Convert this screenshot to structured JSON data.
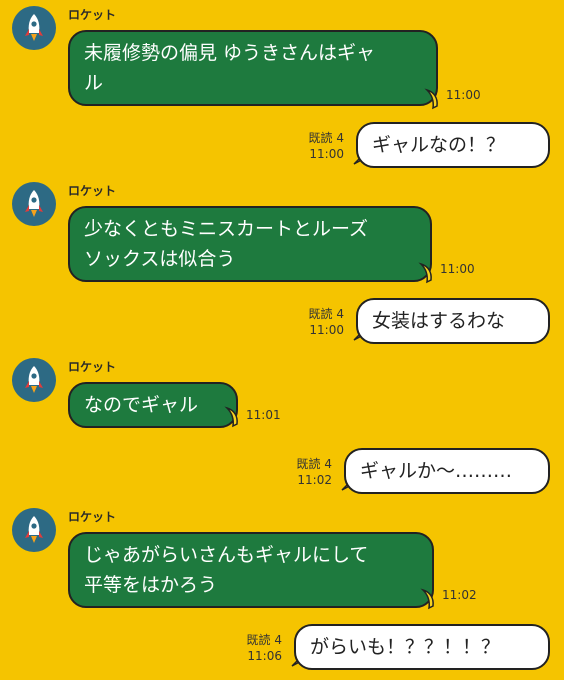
{
  "messages": [
    {
      "sender": "ロケット",
      "text": "未履修勢の偏見 ゆうきさんはギャ\nル",
      "time": "11:00"
    },
    {
      "read": "既読 4",
      "time": "11:00",
      "text": "ギャルなの！？"
    },
    {
      "sender": "ロケット",
      "text": "少なくともミニスカートとルーズ\nソックスは似合う",
      "time": "11:00"
    },
    {
      "read": "既読 4",
      "time": "11:00",
      "text": "女装はするわな"
    },
    {
      "sender": "ロケット",
      "text": "なのでギャル",
      "time": "11:01"
    },
    {
      "read": "既読 4",
      "time": "11:02",
      "text": "ギャルか〜………"
    },
    {
      "sender": "ロケット",
      "text": "じゃあがらいさんもギャルにして\n平等をはかろう",
      "time": "11:02"
    },
    {
      "read": "既読 4",
      "time": "11:06",
      "text": "がらいも！？？！！？"
    }
  ],
  "icons": {
    "avatar": "rocket-icon",
    "incoming_deco": "banana-icon",
    "outgoing_deco": "carrot-icon"
  },
  "colors": {
    "background": "#f5c400",
    "incoming_bubble": "#1e7a3e",
    "outgoing_bubble": "#ffffff",
    "avatar_bg": "#2d6a84"
  }
}
